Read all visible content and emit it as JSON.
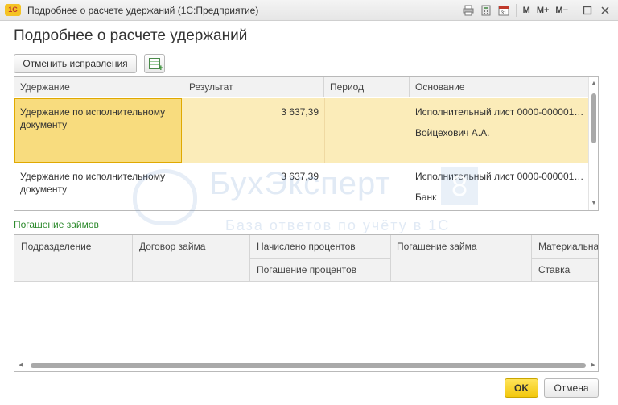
{
  "window": {
    "title": "Подробнее о расчете удержаний  (1С:Предприятие)",
    "logo_text": "1С",
    "toolbar_icons": [
      "print-icon",
      "calculator-icon",
      "calendar-icon"
    ],
    "memory_buttons": [
      "M",
      "M+",
      "M−"
    ],
    "calendar_day": "31"
  },
  "form": {
    "title": "Подробнее о расчете удержаний",
    "revert_button": "Отменить исправления",
    "grid_button_icon": "table-add-icon"
  },
  "deductions_table": {
    "columns": [
      "Удержание",
      "Результат",
      "Период",
      "Основание"
    ],
    "rows": [
      {
        "deduction_line1": "Удержание по исполнительному",
        "deduction_line2": "документу",
        "result": "3 637,39",
        "period": "",
        "basis_line1": "Исполнительный лист 0000-000001 ...",
        "basis_line2": "Войцехович А.А."
      },
      {
        "deduction_line1": "Удержание по исполнительному",
        "deduction_line2": "документу",
        "result": "3 637,39",
        "period": "",
        "basis_line1": "Исполнительный лист 0000-000001 ...",
        "basis_line2": "Банк"
      }
    ]
  },
  "watermark": {
    "title": "БухЭксперт",
    "number": "8",
    "subtitle": "База ответов по учёту в 1С"
  },
  "loans": {
    "section_label": "Погашение займов",
    "columns": {
      "department": "Подразделение",
      "loan_contract": "Договор займа",
      "interest_accrued": "Начислено процентов",
      "interest_repayment": "Погашение процентов",
      "loan_repayment": "Погашение займа",
      "material": "Материальная",
      "rate": "Ставка"
    }
  },
  "buttons": {
    "ok": "OK",
    "cancel": "Отмена"
  },
  "colors": {
    "selected_row": "#fbecb9",
    "selected_cell": "#f8dc7e",
    "selected_border": "#e0a900",
    "section_label": "#2d8a2d",
    "ok_button": "#f2c70c"
  }
}
